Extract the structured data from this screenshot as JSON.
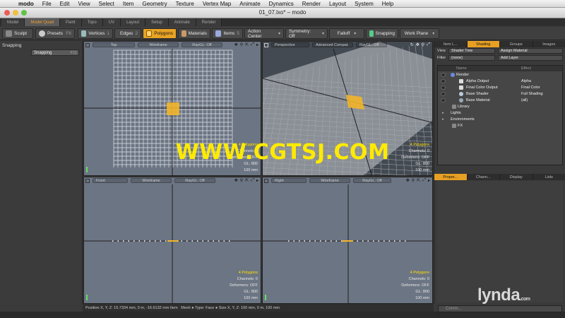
{
  "mac_menu": {
    "app": "modo",
    "items": [
      "File",
      "Edit",
      "View",
      "Select",
      "Item",
      "Geometry",
      "Texture",
      "Vertex Map",
      "Animate",
      "Dynamics",
      "Render",
      "Layout",
      "System",
      "Help"
    ]
  },
  "window": {
    "title": "01_07.lxo* – modo"
  },
  "layout_tabs": [
    "Model",
    "Model Quad",
    "Paint",
    "Topo",
    "UV",
    "Layout",
    "Setup",
    "Animate",
    "Render"
  ],
  "toolbar": {
    "sculpt": "Sculpt",
    "presets": "Presets",
    "presets_key": "F6",
    "vertices": "Vertices",
    "vertices_key": "1",
    "edges": "Edges",
    "edges_key": "2",
    "polygons": "Polygons",
    "polygons_key": "3",
    "materials": "Materials",
    "items": "Items",
    "items_key": "5",
    "action_center": "Action Center",
    "symmetry": "Symmetry: Off",
    "falloff": "Falloff",
    "snapping": "Snapping",
    "work_plane": "Work Plane"
  },
  "left_panel": {
    "header": "Snapping",
    "row_label": "Snapping",
    "row_key": "F11"
  },
  "viewports": [
    {
      "view": "Top",
      "shading": "Wireframe",
      "ray": "RayGL: Off",
      "info": [
        "4 Polygons",
        "Channels: 0",
        "Deformers: OFF",
        "GL: 800",
        "100 mm"
      ]
    },
    {
      "view": "Perspective",
      "shading": "Advanced Compat.",
      "ray": "RayGL: Off",
      "info": [
        "4 Polygons",
        "Channels: 0",
        "Deformers: OFF",
        "GL: 800",
        "100 mm"
      ]
    },
    {
      "view": "Front",
      "shading": "Wireframe",
      "ray": "RayGL: Off",
      "info": [
        "4 Polygons",
        "Channels: 0",
        "Deformers: OFF",
        "GL: 800",
        "100 mm"
      ]
    },
    {
      "view": "Right",
      "shading": "Wireframe",
      "ray": "RayGL: Off",
      "info": [
        "4 Polygons",
        "Channels: 0",
        "Deformers: OFF",
        "GL: 800",
        "100 mm"
      ]
    }
  ],
  "right_panel": {
    "tabs": [
      "Item L...",
      "Shading",
      "Groups",
      "Images"
    ],
    "active_tab": "Shading",
    "view_label": "View",
    "view_value": "Shader Tree",
    "assign_material": "Assign Material",
    "filter_label": "Filter",
    "filter_value": "(none)",
    "add_layer": "Add Layer",
    "columns": {
      "name": "Name",
      "effect": "Effect"
    },
    "rows": [
      {
        "name": "Render",
        "effect": ""
      },
      {
        "name": "Alpha Output",
        "effect": "Alpha"
      },
      {
        "name": "Final Color Output",
        "effect": "Final Color"
      },
      {
        "name": "Base Shader",
        "effect": "Full Shading"
      },
      {
        "name": "Base Material",
        "effect": "(all)"
      },
      {
        "name": "Library",
        "effect": ""
      },
      {
        "name": "Lights",
        "effect": ""
      },
      {
        "name": "Environments",
        "effect": ""
      },
      {
        "name": "FX",
        "effect": ""
      }
    ],
    "bottom_tabs": [
      "Proper...",
      "Chann...",
      "Display",
      "Lists"
    ],
    "command_placeholder": "Comm..."
  },
  "status_bar": {
    "position_label": "Position X, Y, Z:",
    "position_value": "15.7334 mm, 0 m, -16.6132 mm",
    "item_label": "Item",
    "mesh_label": "Mesh",
    "type_label": "Type:",
    "type_value": "Face",
    "size_label": "Size X, Y, Z:",
    "size_value": "100 mm, 0 m, 100 mm"
  },
  "watermark": "WWW.CGTSJ.COM",
  "brand": "lynda",
  "brand_suffix": ".com",
  "colors": {
    "accent": "#e8a324",
    "viewport_bg": "#6b7480",
    "perspective_bg": "#7a7f86",
    "grid": "#d8dce2",
    "selection": "#f2b52a",
    "watermark": "#ffea00"
  }
}
